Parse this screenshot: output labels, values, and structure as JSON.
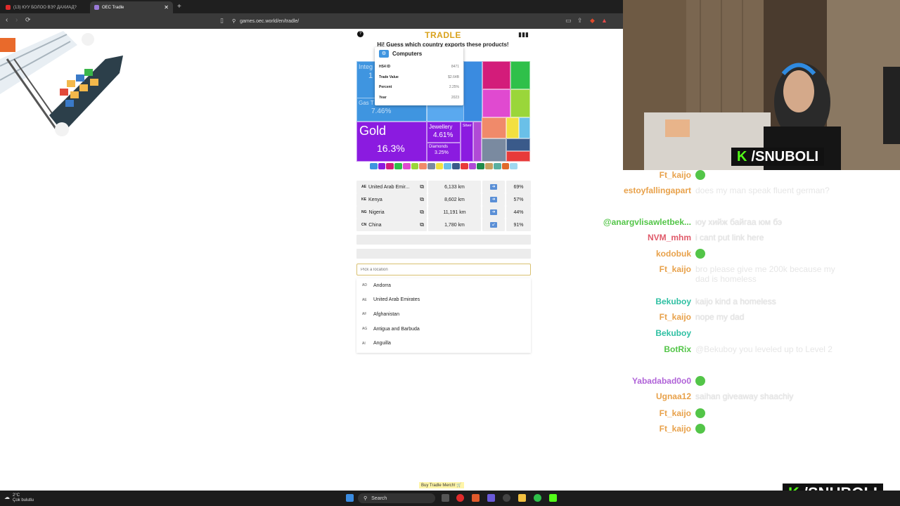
{
  "browser": {
    "tabs": [
      {
        "label": "(13) КУУ БОЛОО ВЭ? ДАХИАД?",
        "active": false
      },
      {
        "label": "OEC Tradle",
        "active": true
      }
    ],
    "new_tab_label": "+",
    "url": "games.oec.world/en/tradle/"
  },
  "tradle": {
    "logo": "TRADLE",
    "prompt": "Hi! Guess which country exports these products!",
    "treemap": {
      "blocks": [
        {
          "label": "Integrated Circuits",
          "short": "Integ Circu",
          "value": "1",
          "color": "#3f95e0"
        },
        {
          "label": "Gas Turbines",
          "short": "Gas T",
          "value": "7.46%",
          "color": "#3f95e0"
        },
        {
          "label": "Gold",
          "value": "16.3%",
          "color": "#8b1be0"
        },
        {
          "label": "Jewellery",
          "value": "4.61%",
          "color": "#8b1be0"
        },
        {
          "label": "Diamonds",
          "value": "3.25%",
          "color": "#8b1be0"
        },
        {
          "label": "Silver",
          "value": "",
          "color": "#8b1be0"
        }
      ]
    },
    "tooltip": {
      "title": "Computers",
      "rows": [
        {
          "key": "HS4 ID",
          "value": "8471"
        },
        {
          "key": "Trade Value",
          "value": "$2.64B"
        },
        {
          "key": "Percent",
          "value": "2.25%"
        },
        {
          "key": "Year",
          "value": "2023"
        }
      ]
    },
    "guesses": [
      {
        "code": "AE",
        "country": "United Arab Emir...",
        "distance": "6,133 km",
        "direction": "right",
        "proximity": "69%"
      },
      {
        "code": "KE",
        "country": "Kenya",
        "distance": "8,602 km",
        "direction": "right",
        "proximity": "57%"
      },
      {
        "code": "NG",
        "country": "Nigeria",
        "distance": "11,191 km",
        "direction": "right",
        "proximity": "44%"
      },
      {
        "code": "CN",
        "country": "China",
        "distance": "1,780 km",
        "direction": "down-left",
        "proximity": "91%"
      }
    ],
    "location_placeholder": "Pick a location",
    "options": [
      {
        "code": "AD",
        "name": "Andorra"
      },
      {
        "code": "AE",
        "name": "United Arab Emirates"
      },
      {
        "code": "AF",
        "name": "Afghanistan"
      },
      {
        "code": "AG",
        "name": "Antigua and Barbuda"
      },
      {
        "code": "AI",
        "name": "Anguilla"
      }
    ],
    "merch_link": "Buy Tradle Merch! 🛒"
  },
  "stream": {
    "brand": "/SNUBOLI",
    "chat": [
      {
        "user": "Ft_kaijo",
        "color": "#e8a14a",
        "text": "",
        "emote": true
      },
      {
        "user": "estoyfallingapart",
        "color": "#e8a14a",
        "text": "does my man speak fluent german?"
      },
      {
        "user": "@anargvlisawletbek...",
        "color": "#53c548",
        "text": "юу хийж байгаа юм бэ"
      },
      {
        "user": "NVM_mhm",
        "color": "#e05a6a",
        "text": "i cant put link here"
      },
      {
        "user": "kodobuk",
        "color": "#e8a14a",
        "text": "",
        "emote": true
      },
      {
        "user": "Ft_kaijo",
        "color": "#e8a14a",
        "text": "bro please give me 200k because my dad is homeless"
      },
      {
        "user": "Bekuboy",
        "color": "#2fc0a3",
        "text": "kaijo kind a homeless"
      },
      {
        "user": "Ft_kaijo",
        "color": "#e8a14a",
        "text": "nope my dad"
      },
      {
        "user": "Bekuboy",
        "color": "#2fc0a3",
        "text": ""
      },
      {
        "user": "BotRix",
        "color": "#53c548",
        "text": "@Bekuboy you leveled up to Level 2"
      },
      {
        "user": "Yabadabad0o0",
        "color": "#b063d8",
        "text": "",
        "emote": true
      },
      {
        "user": "Ugnaa12",
        "color": "#e8a14a",
        "text": "saihan giveaway shaachiy"
      },
      {
        "user": "Ft_kaijo",
        "color": "#e8a14a",
        "text": "",
        "emote": true
      },
      {
        "user": "Ft_kaijo",
        "color": "#e8a14a",
        "text": "",
        "emote": true
      }
    ]
  },
  "taskbar": {
    "temperature": "2°C",
    "weather": "Çok bulutlu",
    "search_label": "Search"
  }
}
